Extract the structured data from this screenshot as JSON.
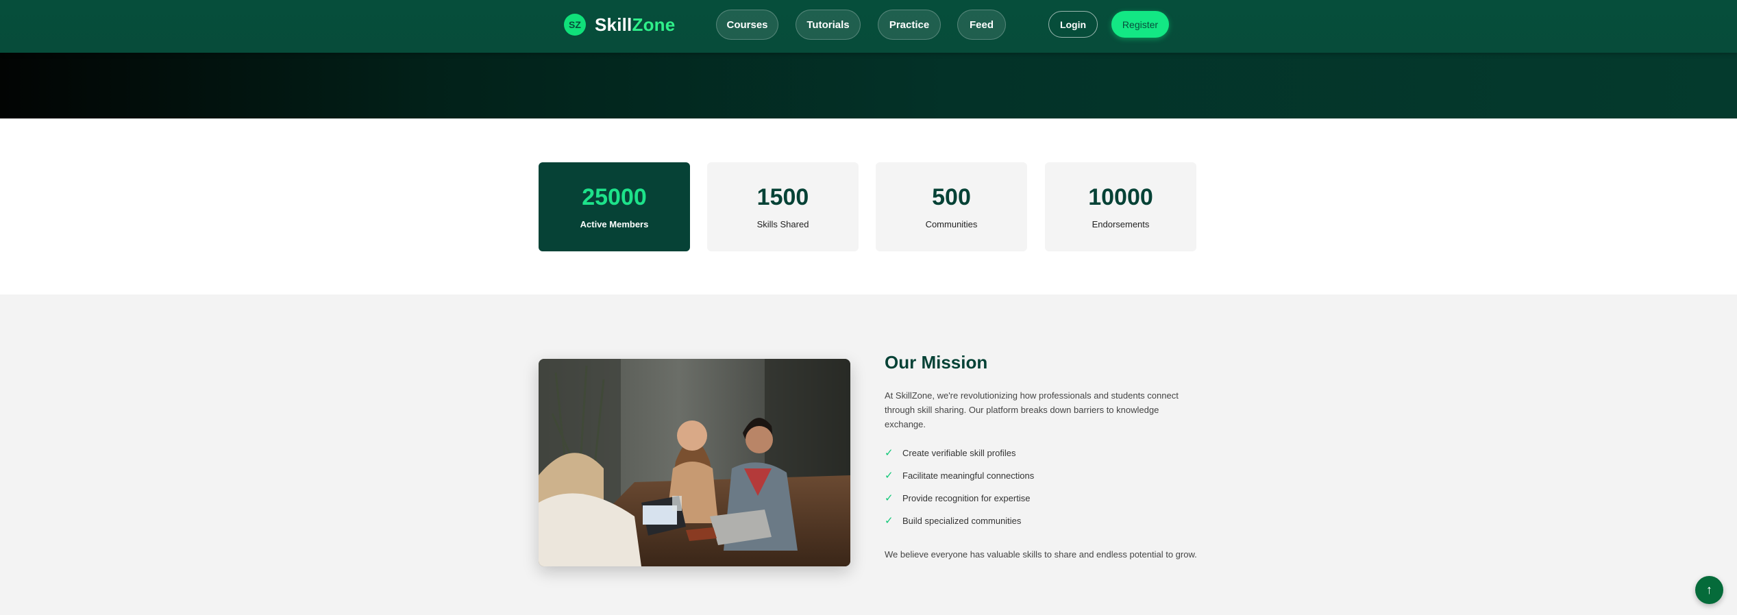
{
  "header": {
    "logo_mark": "SZ",
    "logo_name_part1": "Skill",
    "logo_name_part2": "Zone",
    "nav": [
      "Courses",
      "Tutorials",
      "Practice",
      "Feed"
    ],
    "login_label": "Login",
    "register_label": "Register"
  },
  "stats": [
    {
      "number": "25000",
      "label": "Active Members"
    },
    {
      "number": "1500",
      "label": "Skills Shared"
    },
    {
      "number": "500",
      "label": "Communities"
    },
    {
      "number": "10000",
      "label": "Endorsements"
    }
  ],
  "mission": {
    "title": "Our Mission",
    "description": "At SkillZone, we're revolutionizing how professionals and students connect through skill sharing. Our platform breaks down barriers to knowledge exchange.",
    "check_icon": "✓",
    "items": [
      "Create verifiable skill profiles",
      "Facilitate meaningful connections",
      "Provide recognition for expertise",
      "Build specialized communities"
    ],
    "closing": "We believe everyone has valuable skills to share and endless potential to grow."
  },
  "back_to_top_icon": "↑",
  "colors": {
    "primary": "#064e3b",
    "accent": "#13e784",
    "active_card": "#064236"
  }
}
